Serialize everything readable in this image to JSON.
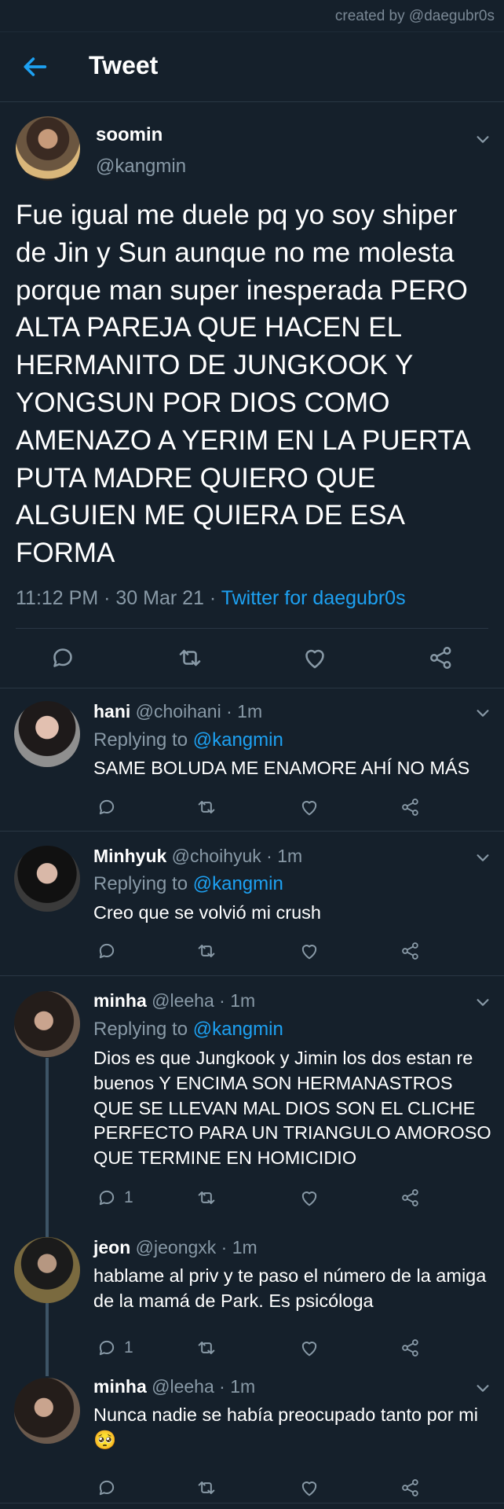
{
  "credit": "created by @daegubr0s",
  "header": {
    "title": "Tweet",
    "back_icon": "arrow-left-icon"
  },
  "colors": {
    "background": "#15202b",
    "accent": "#1da1f2",
    "muted": "#8899a6",
    "divider": "#2a3744"
  },
  "main_tweet": {
    "name": "soomin",
    "handle": "@kangmin",
    "text": "Fue igual me duele pq yo soy shiper de Jin y Sun aunque no me molesta porque man super inesperada PERO ALTA PAREJA QUE HACEN EL HERMANITO DE JUNGKOOK Y YONGSUN POR DIOS COMO AMENAZO A YERIM EN LA PUERTA PUTA MADRE QUIERO QUE ALGUIEN ME QUIERA DE ESA FORMA",
    "time": "11:12 PM",
    "date": "30 Mar 21",
    "source": "Twitter for daegubr0s"
  },
  "replies": [
    {
      "name": "hani",
      "handle": "@choihani",
      "time": "1m",
      "replying_label": "Replying to",
      "replying_to": "@kangmin",
      "text": "SAME BOLUDA ME ENAMORE AHÍ NO MÁS",
      "reply_count": ""
    },
    {
      "name": "Minhyuk",
      "handle": "@choihyuk",
      "time": "1m",
      "replying_label": "Replying to",
      "replying_to": "@kangmin",
      "text": "Creo que se volvió mi crush",
      "reply_count": ""
    },
    {
      "name": "minha",
      "handle": "@leeha",
      "time": "1m",
      "replying_label": "Replying to",
      "replying_to": "@kangmin",
      "text": "Dios es que Jungkook y Jimin los dos estan re buenos Y ENCIMA SON HERMANASTROS QUE SE LLEVAN MAL DIOS SON EL CLICHE PERFECTO PARA UN TRIANGULO AMOROSO QUE TERMINE EN HOMICIDIO",
      "reply_count": "1"
    },
    {
      "name": "jeon",
      "handle": "@jeongxk",
      "time": "1m",
      "text": "hablame al priv y te paso el número de la amiga de la mamá de Park. Es psicóloga",
      "reply_count": "1"
    },
    {
      "name": "minha",
      "handle": "@leeha",
      "time": "1m",
      "text": "Nunca nadie se había preocupado tanto por mi 🥺",
      "reply_count": ""
    }
  ],
  "icons": [
    "reply-icon",
    "retweet-icon",
    "like-icon",
    "share-icon",
    "chevron-down-icon"
  ]
}
